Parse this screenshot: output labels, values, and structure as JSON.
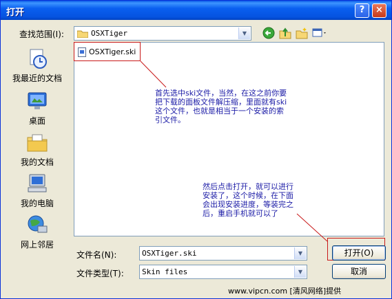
{
  "window": {
    "title": "打开",
    "help_glyph": "?",
    "close_glyph": "×"
  },
  "lookin": {
    "label": "查找范围(I):",
    "value": "OSXTiger",
    "arrow": "▼"
  },
  "toolbar_icons": [
    "back-icon",
    "up-folder-icon",
    "new-folder-icon",
    "view-menu-icon"
  ],
  "places": [
    {
      "label": "我最近的文档",
      "icon": "recent-documents-icon"
    },
    {
      "label": "桌面",
      "icon": "desktop-icon"
    },
    {
      "label": "我的文档",
      "icon": "my-documents-icon"
    },
    {
      "label": "我的电脑",
      "icon": "my-computer-icon"
    },
    {
      "label": "网上邻居",
      "icon": "network-places-icon"
    }
  ],
  "files": [
    {
      "name": "OSXTiger.ski"
    }
  ],
  "annotations": {
    "first": [
      "首先选中ski文件，当然，在这之前你要",
      "把下载的面板文件解压缩，里面就有ski",
      "这个文件，也就是相当于一个安装的索",
      "引文件。"
    ],
    "second": [
      "然后点击打开，就可以进行",
      "安装了，这个时候，在下面",
      "会出现安装进度，等装完之",
      "后，重启手机就可以了"
    ]
  },
  "filename": {
    "label": "文件名(N):",
    "value": "OSXTiger.ski",
    "arrow": "▼"
  },
  "filetype": {
    "label": "文件类型(T):",
    "value": "Skin files",
    "arrow": "▼"
  },
  "buttons": {
    "open": "打开(O)",
    "cancel": "取消"
  },
  "watermark": "www.vipcn.com [清风网络]提供",
  "colors": {
    "title_bar": "#0a5ff0",
    "annotation_red": "#c81818",
    "annotation_text": "#1a1aa6"
  }
}
